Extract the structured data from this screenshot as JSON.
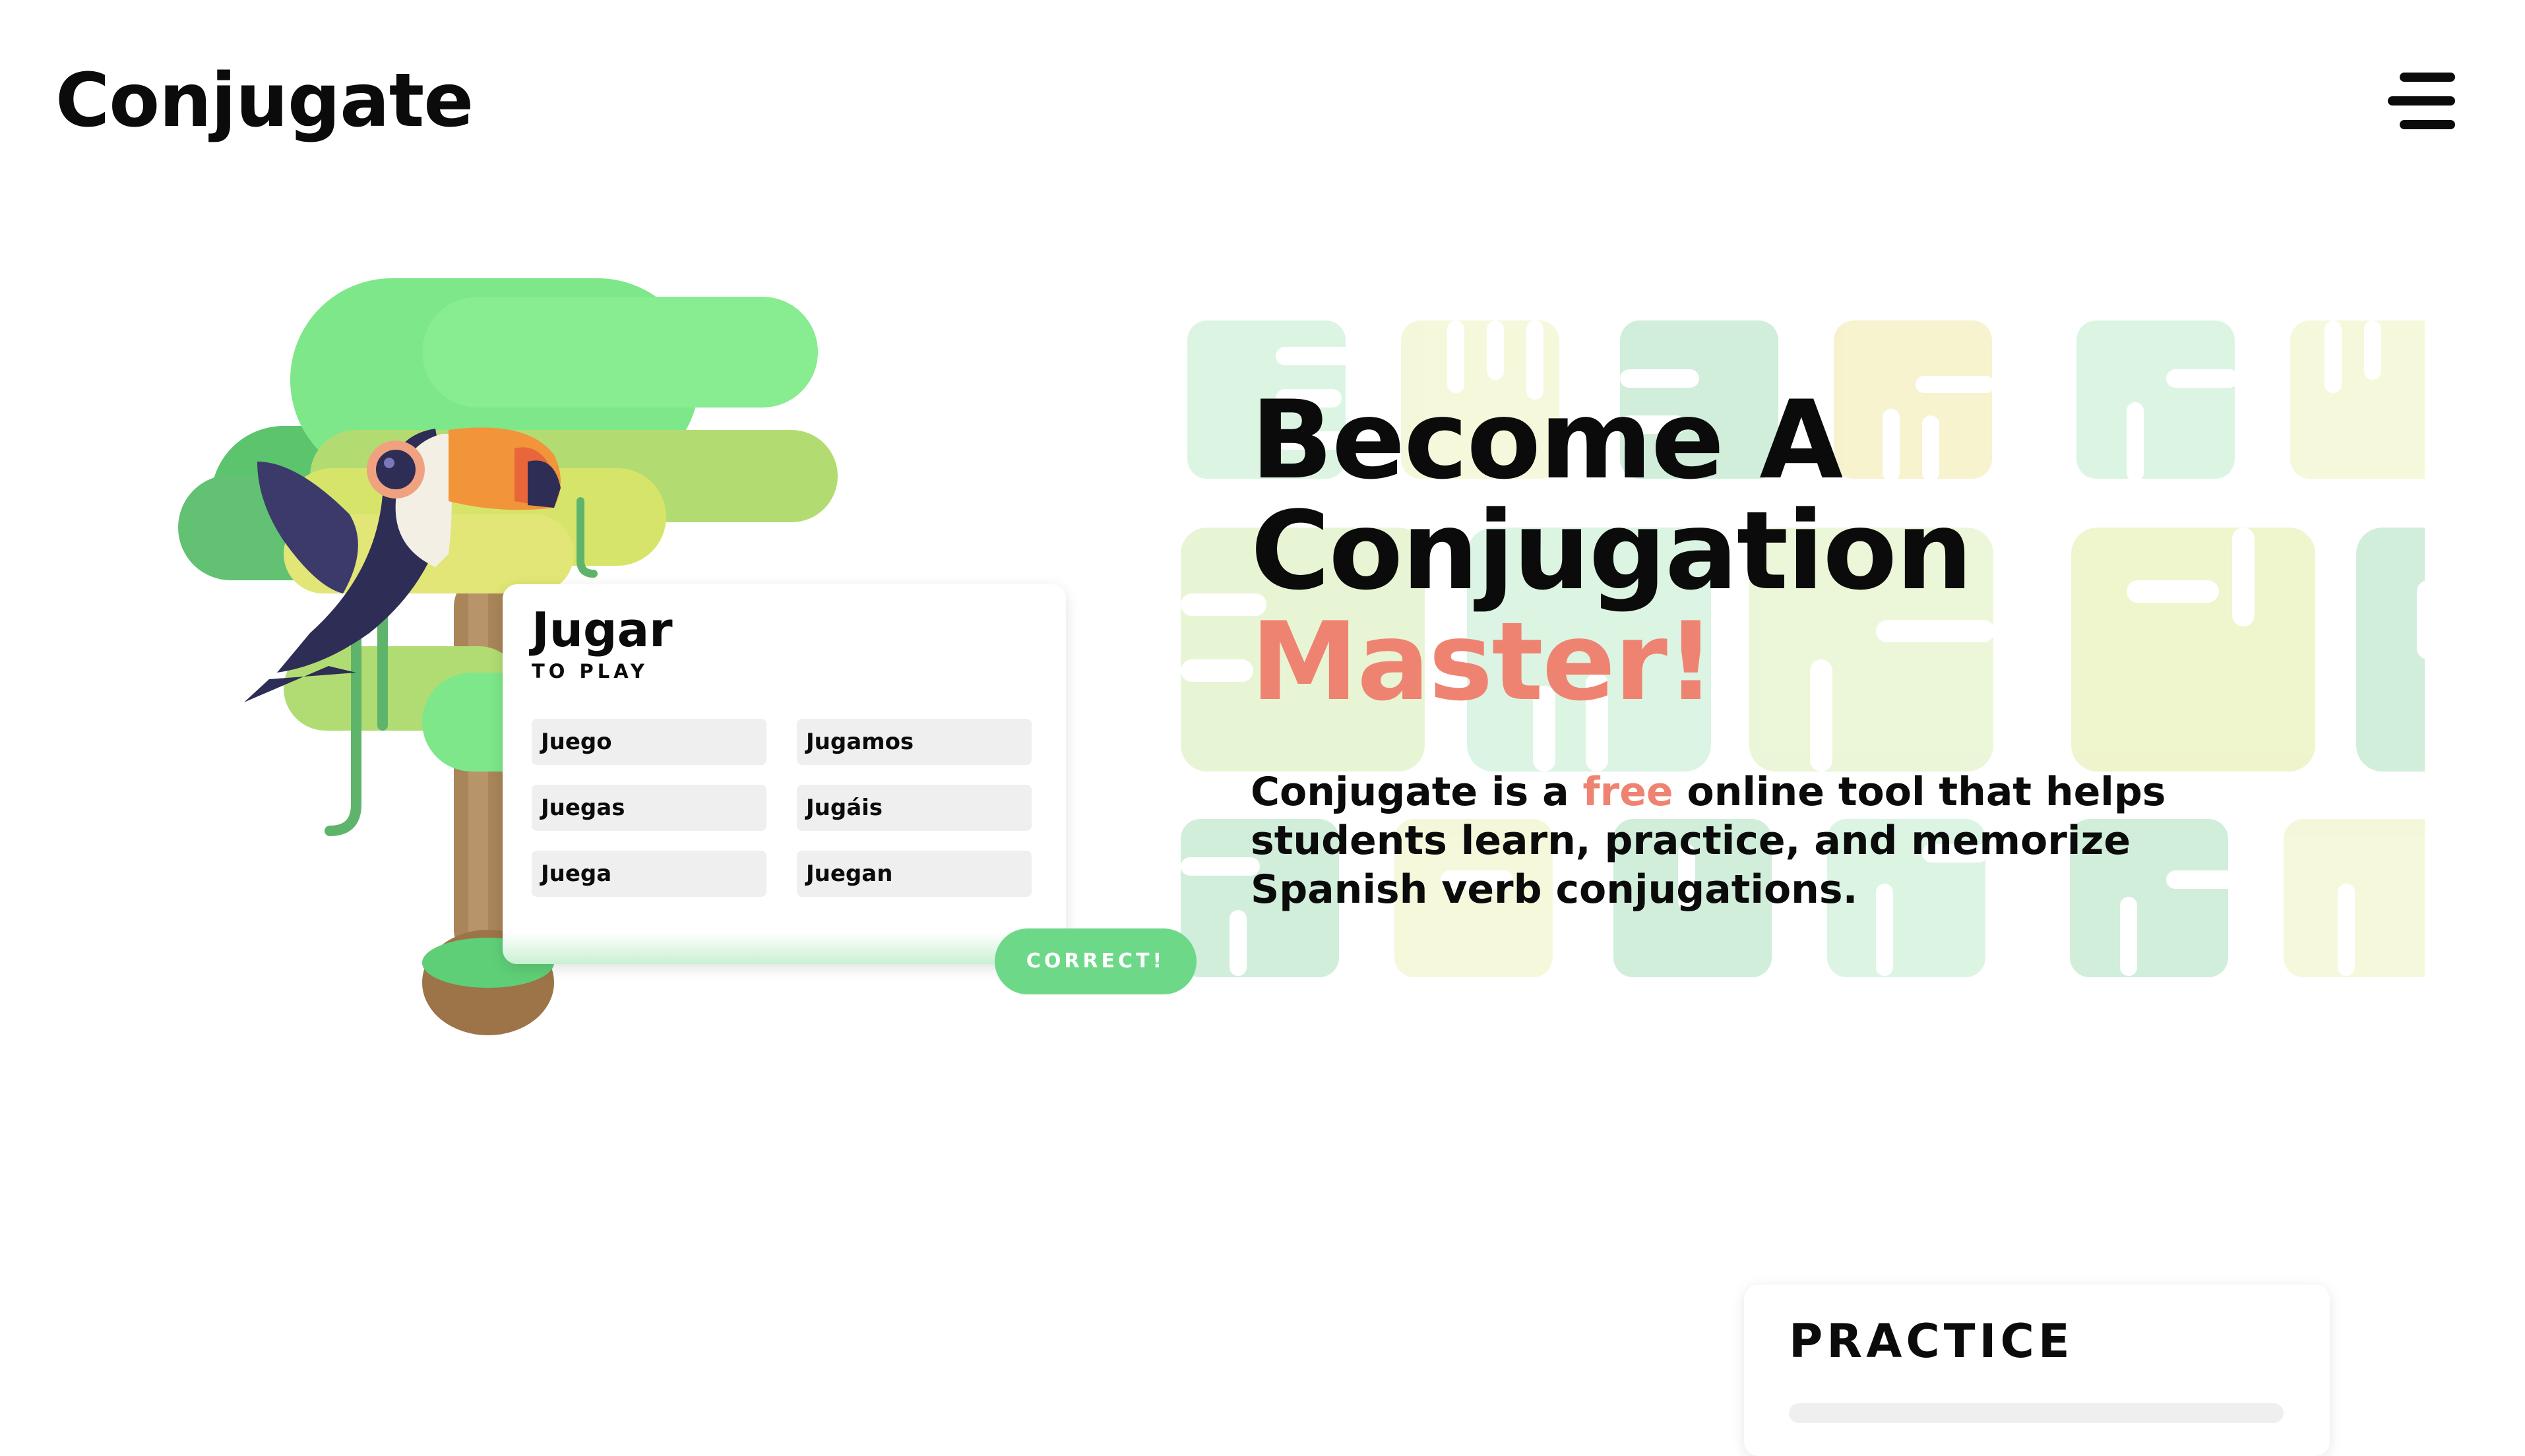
{
  "header": {
    "logo": "Conjugate",
    "menu_icon": "hamburger-menu-icon"
  },
  "illustration": {
    "bird": "toucan",
    "card": {
      "verb": "Jugar",
      "translation": "TO PLAY",
      "conjugations": [
        "Juego",
        "Jugamos",
        "Juegas",
        "Jugáis",
        "Juega",
        "Juegan"
      ],
      "button": "CORRECT!"
    }
  },
  "hero": {
    "heading_line1": "Become A",
    "heading_line2": "Conjugation",
    "heading_accent": "Master!",
    "desc_before": "Conjugate is a ",
    "desc_highlight": "free",
    "desc_after": " online tool that helps students learn, practice, and memorize Spanish verb conjugations."
  },
  "practice": {
    "title": "PRACTICE"
  },
  "colors": {
    "accent": "#ef8371",
    "green": "#6ed889",
    "text": "#0b0b0b",
    "toucan_body": "#2e2d55",
    "beak": "#f2943a"
  }
}
